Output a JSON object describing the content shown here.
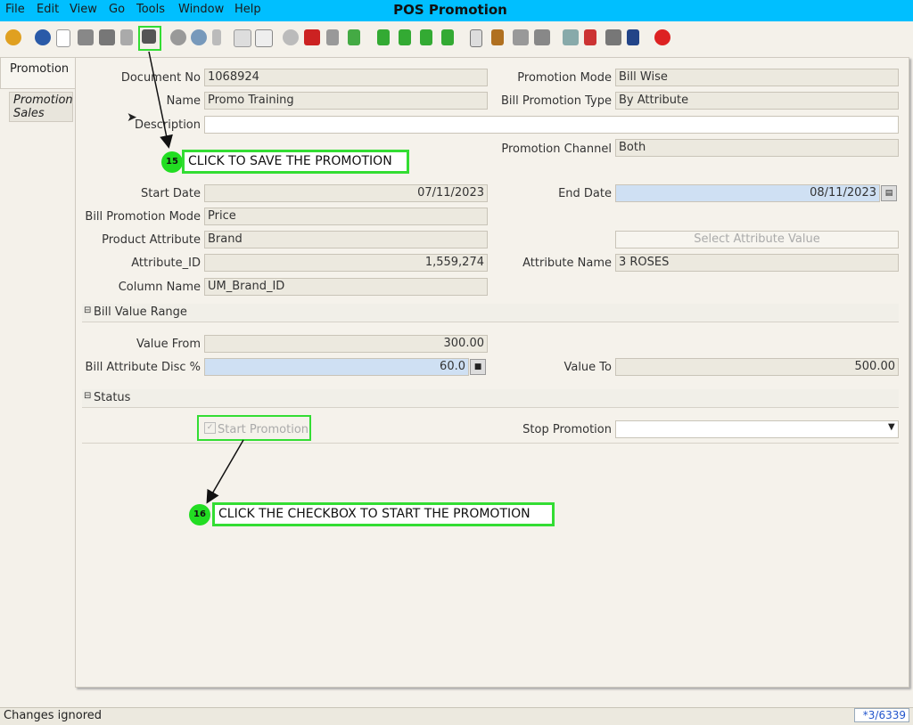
{
  "window": {
    "title": "POS Promotion"
  },
  "menu": {
    "file": "File",
    "edit": "Edit",
    "view": "View",
    "go": "Go",
    "tools": "Tools",
    "window": "Window",
    "help": "Help"
  },
  "toolbar": {
    "icons": [
      "undo-icon",
      "help-icon",
      "new-record-icon",
      "copy-record-icon",
      "delete-icon",
      "delete-selection-icon",
      "save-icon",
      "refresh-icon",
      "find-icon",
      "attachment-icon",
      "chat-icon",
      "grid-toggle-icon",
      "history-icon",
      "home-icon",
      "back-icon",
      "forward-icon",
      "first-record-icon",
      "previous-record-icon",
      "next-record-icon",
      "last-record-icon",
      "report-icon",
      "archive-icon",
      "print-preview-icon",
      "print-icon",
      "zoom-across-icon",
      "workflow-icon",
      "product-info-icon",
      "lock-icon",
      "exit-icon"
    ],
    "accent": "#00bfff"
  },
  "tabs": {
    "promotion": "Promotion",
    "promotion_sales": "Promotion Sales"
  },
  "form": {
    "document_no": {
      "label": "Document No",
      "value": "1068924"
    },
    "name": {
      "label": "Name",
      "value": "Promo Training"
    },
    "description": {
      "label": "Description",
      "value": ""
    },
    "promotion_mode": {
      "label": "Promotion Mode",
      "value": "Bill Wise"
    },
    "bill_promotion_type": {
      "label": "Bill Promotion Type",
      "value": "By Attribute"
    },
    "promotion_channel": {
      "label": "Promotion Channel",
      "value": "Both"
    },
    "start_date": {
      "label": "Start Date",
      "value": "07/11/2023"
    },
    "end_date": {
      "label": "End Date",
      "value": "08/11/2023"
    },
    "bill_promotion_mode": {
      "label": "Bill Promotion Mode",
      "value": "Price"
    },
    "product_attribute": {
      "label": "Product Attribute",
      "value": "Brand"
    },
    "select_attribute_value": "Select Attribute Value",
    "attribute_id": {
      "label": "Attribute_ID",
      "value": "1,559,274"
    },
    "attribute_name": {
      "label": "Attribute Name",
      "value": "3 ROSES"
    },
    "column_name": {
      "label": "Column Name",
      "value": "UM_Brand_ID"
    }
  },
  "bill_value_range": {
    "header": "Bill Value Range",
    "value_from": {
      "label": "Value From",
      "value": "300.00"
    },
    "bill_attribute_disc": {
      "label": "Bill Attribute Disc %",
      "value": "60.0"
    },
    "value_to": {
      "label": "Value To",
      "value": "500.00"
    }
  },
  "status": {
    "header": "Status",
    "start_promotion": {
      "label": "Start Promotion",
      "checked": true
    },
    "stop_promotion": {
      "label": "Stop Promotion",
      "value": ""
    }
  },
  "annotations": {
    "step15": {
      "number": "15",
      "text": "CLICK TO SAVE THE PROMOTION"
    },
    "step16": {
      "number": "16",
      "text": "CLICK THE CHECKBOX TO START THE PROMOTION"
    },
    "highlight_color": "#33dd33"
  },
  "statusbar": {
    "message": "Changes ignored",
    "record": "*3/6339"
  }
}
